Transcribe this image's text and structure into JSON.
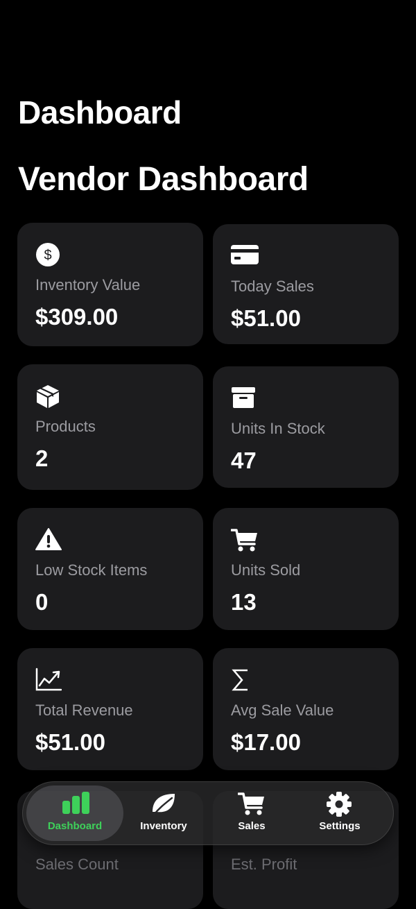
{
  "header": {
    "nav_title": "Dashboard",
    "page_title": "Vendor Dashboard"
  },
  "cards": [
    {
      "label": "Inventory Value",
      "value": "$309.00",
      "icon": "dollar-circle-icon"
    },
    {
      "label": "Today Sales",
      "value": "$51.00",
      "icon": "credit-card-icon"
    },
    {
      "label": "Products",
      "value": "2",
      "icon": "cube-icon"
    },
    {
      "label": "Units In Stock",
      "value": "47",
      "icon": "archive-box-icon"
    },
    {
      "label": "Low Stock Items",
      "value": "0",
      "icon": "warning-triangle-icon"
    },
    {
      "label": "Units Sold",
      "value": "13",
      "icon": "cart-icon"
    },
    {
      "label": "Total Revenue",
      "value": "$51.00",
      "icon": "trend-chart-icon"
    },
    {
      "label": "Avg Sale Value",
      "value": "$17.00",
      "icon": "sigma-icon"
    },
    {
      "label": "Sales Count",
      "icon": "list-icon"
    },
    {
      "label": "Est. Profit",
      "icon": "money-icon"
    }
  ],
  "tabbar": {
    "tabs": [
      {
        "label": "Dashboard",
        "icon": "bar-chart-icon",
        "active": true
      },
      {
        "label": "Inventory",
        "icon": "leaf-icon",
        "active": false
      },
      {
        "label": "Sales",
        "icon": "cart-icon",
        "active": false
      },
      {
        "label": "Settings",
        "icon": "gear-icon",
        "active": false
      }
    ]
  },
  "colors": {
    "background": "#000000",
    "card": "#1c1c1e",
    "label": "#9c9ca1",
    "accent": "#3ed15a"
  }
}
